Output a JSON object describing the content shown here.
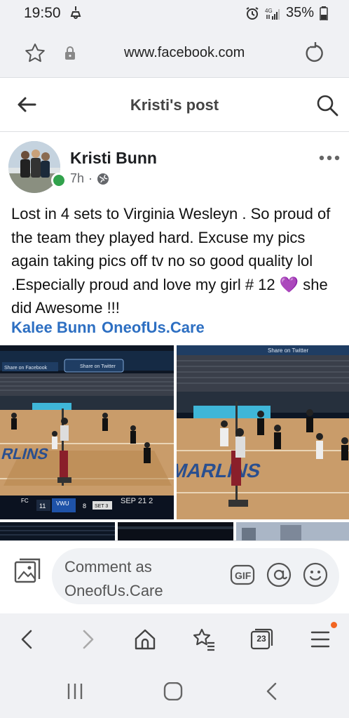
{
  "status_bar": {
    "time": "19:50",
    "battery": "35%"
  },
  "browser": {
    "url": "www.facebook.com"
  },
  "header": {
    "title": "Kristi's post"
  },
  "post": {
    "author": "Kristi Bunn",
    "time_ago": "7h",
    "separator": "·",
    "text_before_emoji": "Lost in 4 sets to Virginia Wesleyn . So proud of the team they played hard. Excuse my pics again taking pics off tv no so good quality lol .Especially proud and love my girl # 12 ",
    "emoji": "💜",
    "text_after_emoji": " she did Awesome !!!",
    "tags": [
      "Kalee Bunn",
      "OneofUs.Care"
    ]
  },
  "photos": {
    "photo_1": {
      "share_facebook": "Share on Facebook",
      "share_twitter": "Share on Twitter",
      "court_text": "MARLINS",
      "score_team_a": "FC",
      "score_a": "11",
      "score_team_b": "VWU",
      "score_b": "8",
      "set": "SET 3",
      "date": "SEP 21 2"
    },
    "photo_2": {
      "banner": "Share on Twitter",
      "court_text": "MARLINS"
    }
  },
  "comment": {
    "placeholder": "Comment as OneofUs.Care",
    "gif_label": "GIF"
  },
  "toolbar": {
    "tabs_count": "23"
  },
  "colors": {
    "online": "#31a24c",
    "link": "#2d6fc2",
    "notification_dot": "#f26522"
  }
}
